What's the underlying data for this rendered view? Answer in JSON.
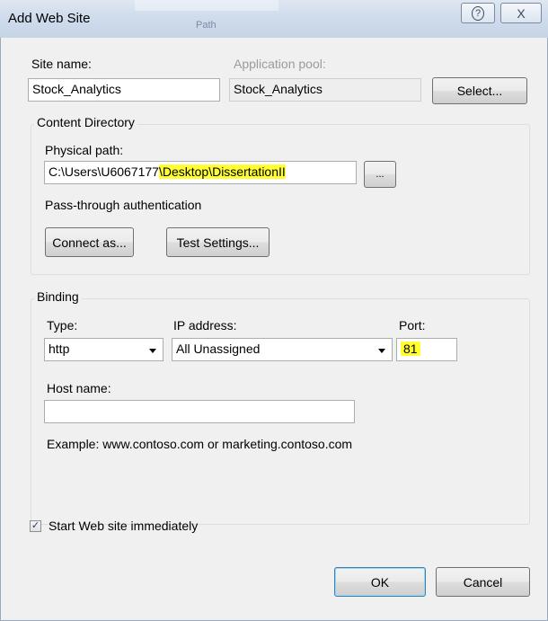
{
  "window": {
    "title": "Add Web Site",
    "help_glyph": "?",
    "close_glyph": "X",
    "background_title_text": "Path"
  },
  "site": {
    "name_label": "Site name:",
    "name_value": "Stock_Analytics",
    "pool_label": "Application pool:",
    "pool_value": "Stock_Analytics",
    "select_button": "Select..."
  },
  "content_directory": {
    "group_title": "Content Directory",
    "physical_path_label": "Physical path:",
    "physical_path_prefix": "C:\\Users\\U6067177",
    "physical_path_highlighted": "\\Desktop\\DissertationII",
    "browse_button": "...",
    "passthrough_label": "Pass-through authentication",
    "connect_as_button": "Connect as...",
    "test_settings_button": "Test Settings..."
  },
  "binding": {
    "group_title": "Binding",
    "type_label": "Type:",
    "type_value": "http",
    "ip_label": "IP address:",
    "ip_value": "All Unassigned",
    "port_label": "Port:",
    "port_value": "81",
    "host_label": "Host name:",
    "host_value": "",
    "example_text": "Example: www.contoso.com or marketing.contoso.com"
  },
  "start_immediately": {
    "checked": true,
    "check_glyph": "✓",
    "label": "Start Web site immediately"
  },
  "footer": {
    "ok_button": "OK",
    "cancel_button": "Cancel"
  },
  "colors": {
    "highlight": "#ffff33",
    "titlebar": "#cfdcec"
  }
}
